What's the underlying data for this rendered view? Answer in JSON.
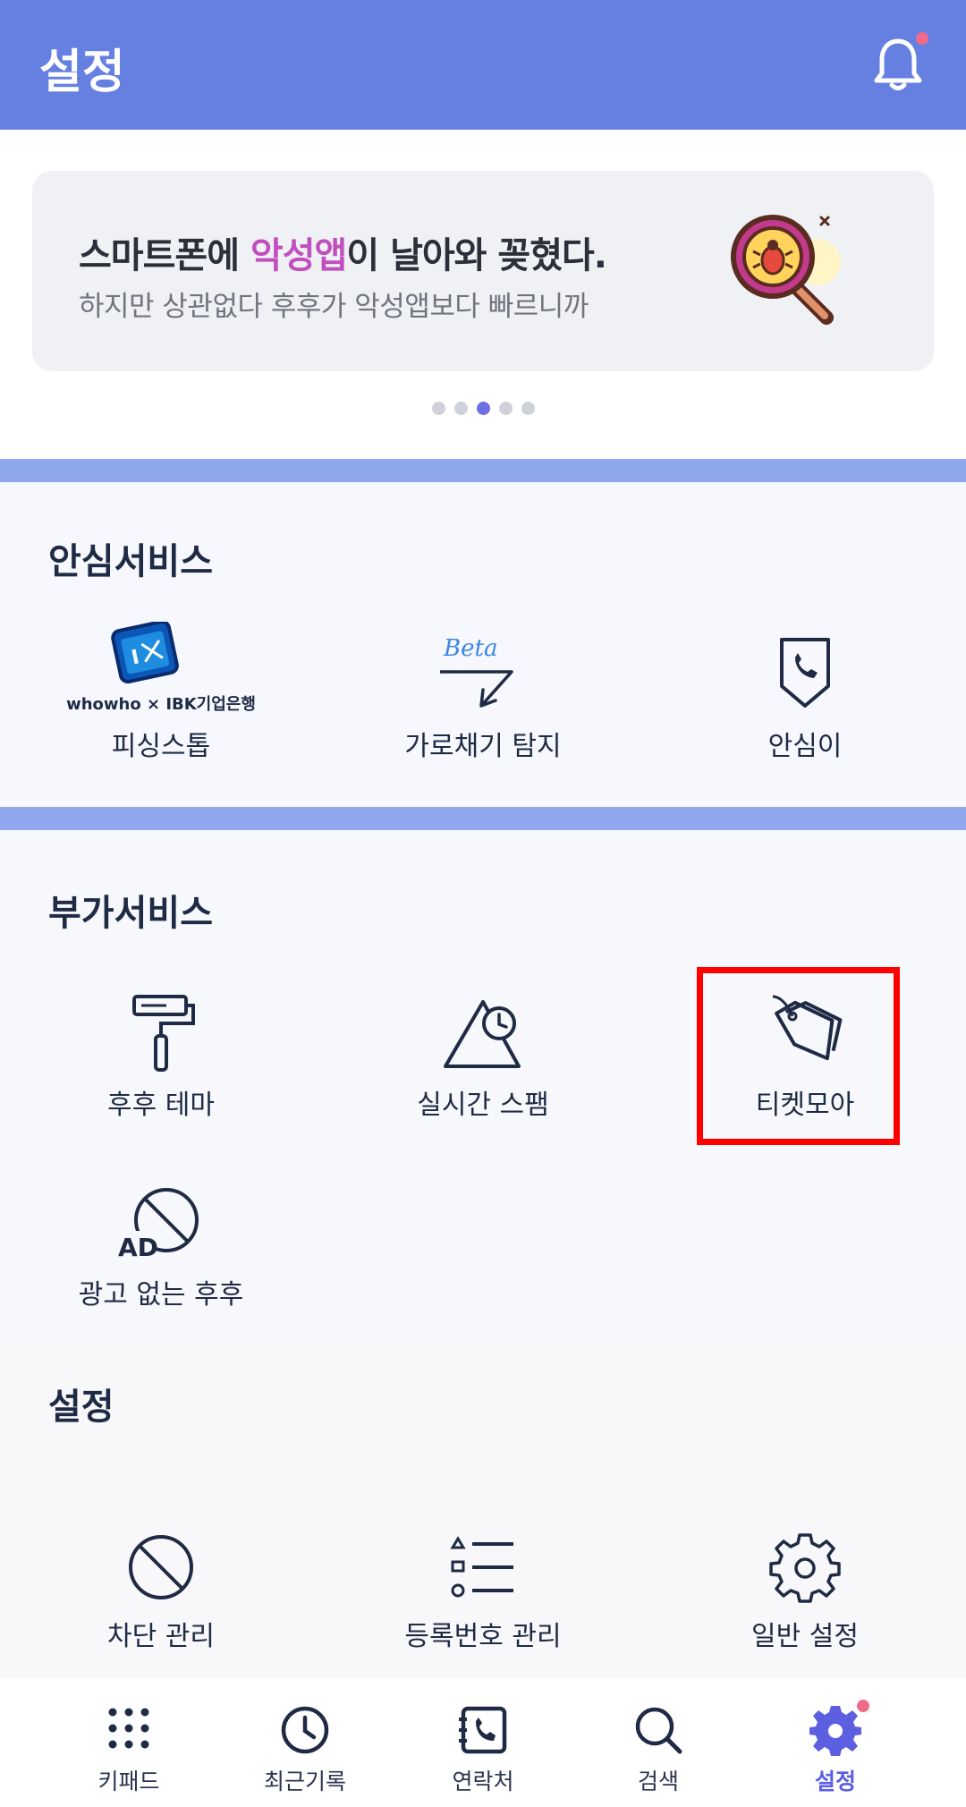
{
  "header": {
    "title": "설정"
  },
  "banner": {
    "headline_before": "스마트폰에 ",
    "headline_highlight": "악성앱",
    "headline_after": "이 날아와 꽂혔다.",
    "subline": "하지만 상관없다 후후가 악성앱보다 빠르니까",
    "page_count": 5,
    "active_page": 3
  },
  "safety": {
    "title": "안심서비스",
    "items": [
      {
        "label": "피싱스톱",
        "logo_text": "whowho × IBK기업은행",
        "icon": "ibk-logo-icon"
      },
      {
        "label": "가로채기 탐지",
        "badge": "Beta",
        "icon": "intercept-arrow-icon"
      },
      {
        "label": "안심이",
        "icon": "shield-phone-icon"
      }
    ]
  },
  "extra": {
    "title": "부가서비스",
    "items": [
      {
        "label": "후후 테마",
        "icon": "paint-roller-icon"
      },
      {
        "label": "실시간 스팸",
        "icon": "triangle-clock-icon"
      },
      {
        "label": "티켓모아",
        "icon": "ticket-tag-icon"
      },
      {
        "label": "광고 없는 후후",
        "icon": "no-ad-icon",
        "ad_text": "AD"
      }
    ]
  },
  "settings": {
    "title": "설정",
    "items": [
      {
        "label": "차단 관리",
        "icon": "block-icon"
      },
      {
        "label": "등록번호 관리",
        "icon": "list-icon"
      },
      {
        "label": "일반 설정",
        "icon": "gear-icon"
      }
    ]
  },
  "tabbar": {
    "items": [
      {
        "label": "키패드",
        "icon": "keypad-icon"
      },
      {
        "label": "최근기록",
        "icon": "clock-icon"
      },
      {
        "label": "연락처",
        "icon": "contacts-icon"
      },
      {
        "label": "검색",
        "icon": "search-icon"
      },
      {
        "label": "설정",
        "icon": "gear-icon",
        "active": true
      }
    ]
  },
  "colors": {
    "header_bg": "#6580e0",
    "accent": "#5b5fe0",
    "highlight": "#c14fbe",
    "notification_dot": "#f06a8a"
  }
}
